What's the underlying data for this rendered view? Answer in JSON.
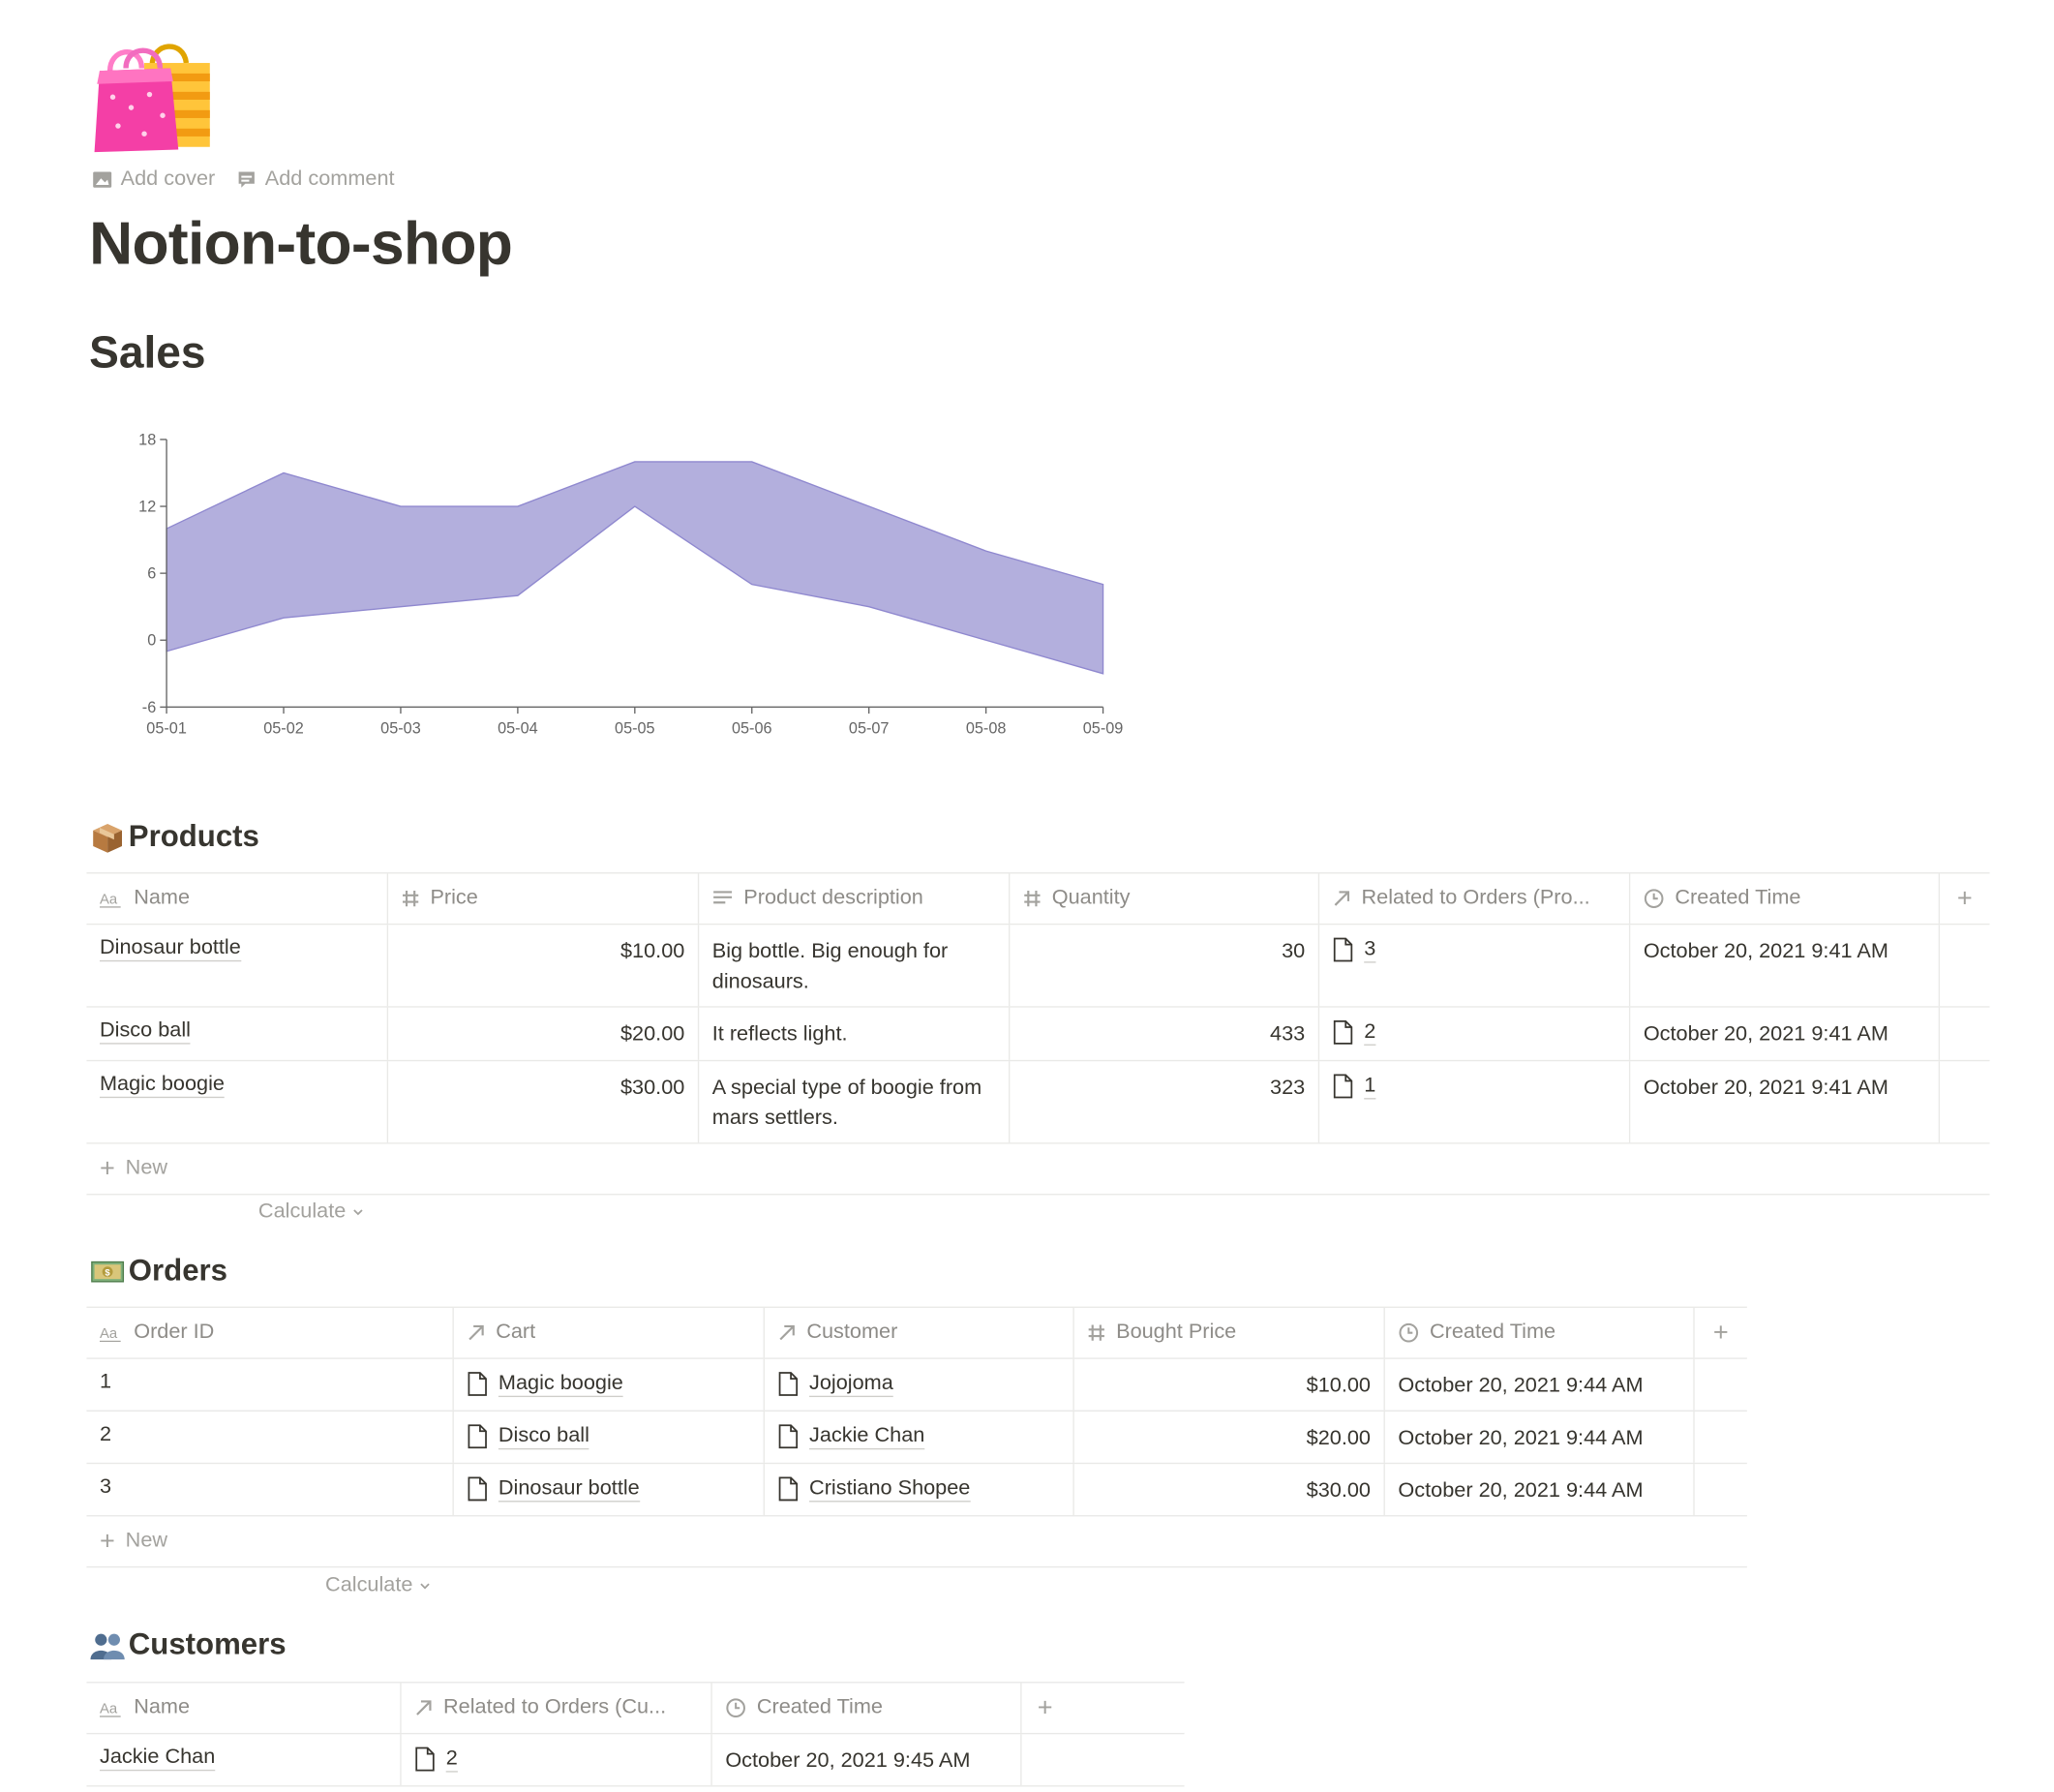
{
  "page": {
    "icon": "shopping-bags-icon",
    "actions": {
      "add_cover": "Add cover",
      "add_comment": "Add comment"
    },
    "title": "Notion-to-shop"
  },
  "sales": {
    "heading": "Sales",
    "colors": {
      "fill": "#b3afdd",
      "stroke": "#8f88cf",
      "axis": "#666666"
    }
  },
  "chart_data": {
    "type": "area",
    "title": "",
    "xlabel": "",
    "ylabel": "",
    "x": [
      "05-01",
      "05-02",
      "05-03",
      "05-04",
      "05-05",
      "05-06",
      "05-07",
      "05-08",
      "05-09"
    ],
    "series": [
      {
        "values": [
          10,
          15,
          12,
          12,
          16,
          16,
          12,
          8,
          5
        ]
      },
      {
        "values": [
          -1,
          2,
          3,
          4,
          12,
          5,
          3,
          0,
          -3
        ]
      }
    ],
    "ylim": [
      -6,
      18
    ],
    "yticks": [
      -6,
      0,
      6,
      12,
      18
    ],
    "grid": false,
    "legend": "none"
  },
  "products": {
    "heading": "Products",
    "emoji": "package-icon",
    "columns": [
      "Name",
      "Price",
      "Product description",
      "Quantity",
      "Related to Orders (Pro...",
      "Created Time"
    ],
    "rows": [
      {
        "name": "Dinosaur bottle",
        "price": "$10.00",
        "desc": "Big bottle. Big enough for dinosaurs.",
        "qty": "30",
        "rel": "3",
        "created": "October 20, 2021 9:41 AM"
      },
      {
        "name": "Disco ball",
        "price": "$20.00",
        "desc": "It reflects light.",
        "qty": "433",
        "rel": "2",
        "created": "October 20, 2021 9:41 AM"
      },
      {
        "name": "Magic boogie",
        "price": "$30.00",
        "desc": "A special type of boogie from mars settlers.",
        "qty": "323",
        "rel": "1",
        "created": "October 20, 2021 9:41 AM"
      }
    ],
    "new_label": "New",
    "calculate_label": "Calculate"
  },
  "orders": {
    "heading": "Orders",
    "emoji": "money-icon",
    "columns": [
      "Order ID",
      "Cart",
      "Customer",
      "Bought Price",
      "Created Time"
    ],
    "rows": [
      {
        "id": "1",
        "cart": "Magic boogie",
        "customer": "Jojojoma",
        "price": "$10.00",
        "created": "October 20, 2021 9:44 AM"
      },
      {
        "id": "2",
        "cart": "Disco ball",
        "customer": "Jackie Chan",
        "price": "$20.00",
        "created": "October 20, 2021 9:44 AM"
      },
      {
        "id": "3",
        "cart": "Dinosaur bottle",
        "customer": "Cristiano Shopee",
        "price": "$30.00",
        "created": "October 20, 2021 9:44 AM"
      }
    ],
    "new_label": "New",
    "calculate_label": "Calculate"
  },
  "customers": {
    "heading": "Customers",
    "emoji": "people-icon",
    "columns": [
      "Name",
      "Related to Orders (Cu...",
      "Created Time"
    ],
    "rows": [
      {
        "name": "Jackie Chan",
        "rel": "2",
        "created": "October 20, 2021 9:45 AM"
      }
    ]
  }
}
